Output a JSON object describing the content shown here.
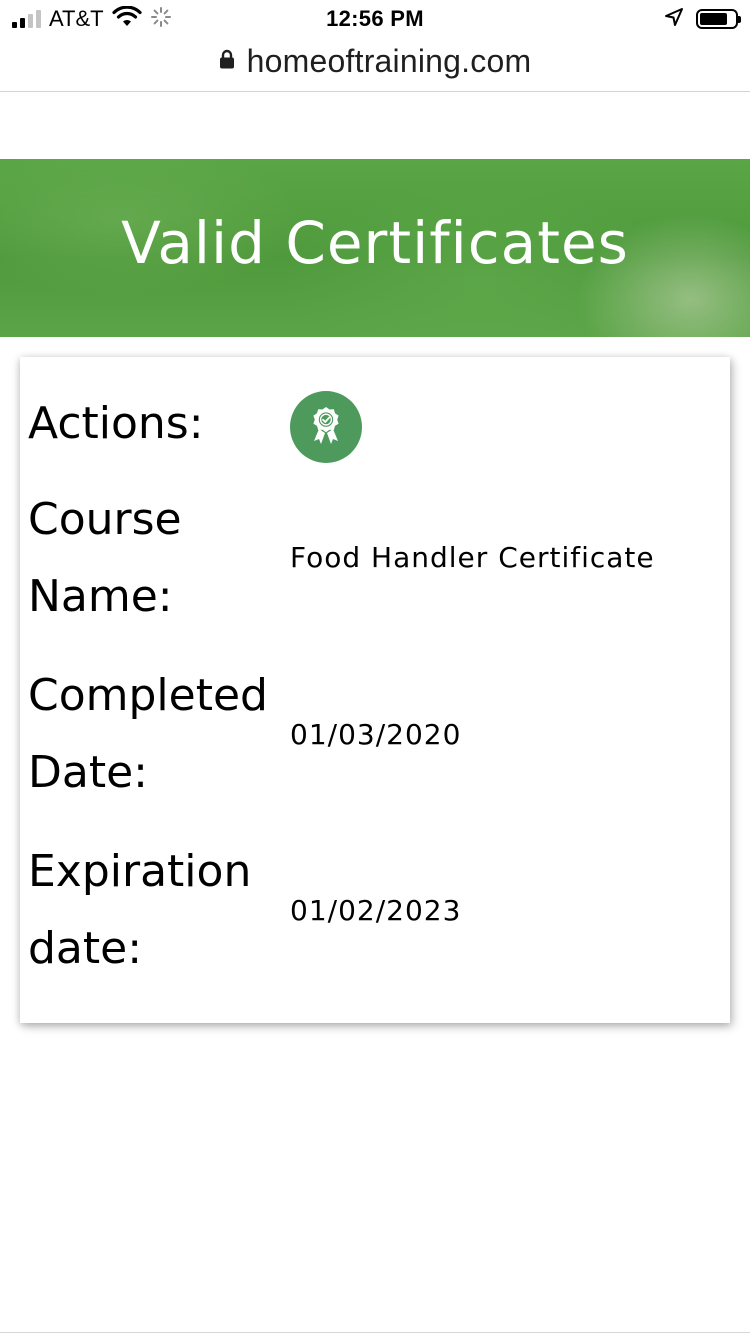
{
  "status_bar": {
    "carrier": "AT&T",
    "time": "12:56 PM",
    "icons": [
      "signal-icon",
      "wifi-icon",
      "activity-spinner-icon",
      "location-icon",
      "battery-icon"
    ]
  },
  "browser": {
    "url": "homeoftraining.com",
    "icons": [
      "lock-icon"
    ]
  },
  "header": {
    "title": "Valid Certificates",
    "color": "#52a040"
  },
  "certificate": {
    "actions_label": "Actions:",
    "action_icon": "certificate-badge-icon",
    "action_button_color": "#4e9a5c",
    "course_name_label_line1": "Course",
    "course_name_label_line2": "Name:",
    "course_name": "Food Handler Certificate",
    "completed_label_line1": "Completed",
    "completed_label_line2": "Date:",
    "completed_date": "01/03/2020",
    "expiration_label_line1": "Expiration",
    "expiration_label_line2": "date:",
    "expiration_date": "01/02/2023"
  }
}
